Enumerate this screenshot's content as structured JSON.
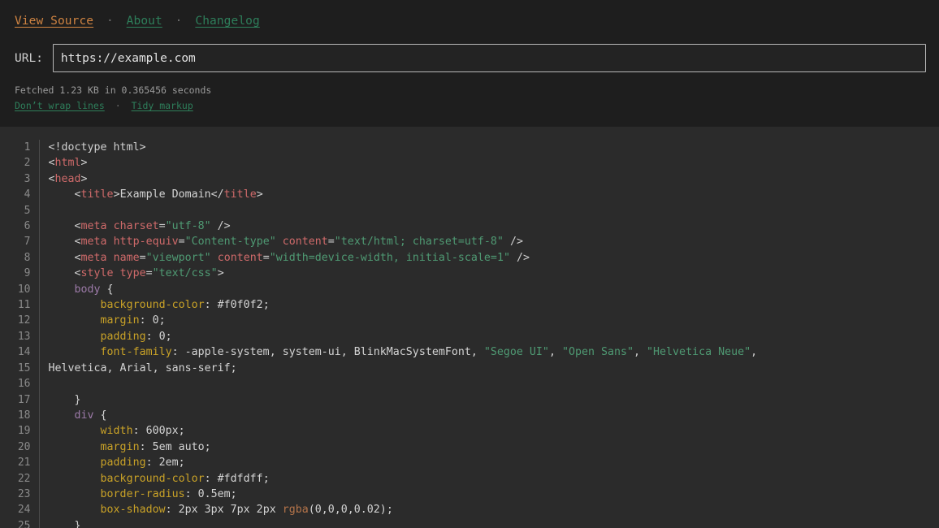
{
  "header": {
    "nav": [
      {
        "label": "View Source",
        "state": "active"
      },
      {
        "label": "About",
        "state": "normal"
      },
      {
        "label": "Changelog",
        "state": "normal"
      }
    ],
    "nav_separator": "·",
    "url_label": "URL:",
    "url_value": "https://example.com",
    "url_placeholder": "https://example.com",
    "fetch_info": "Fetched 1.23 KB in 0.365456 seconds",
    "options": [
      {
        "label": "Don’t wrap lines"
      },
      {
        "label": "Tidy markup"
      }
    ],
    "option_separator": "·"
  },
  "colors": {
    "header_bg": "#1e1e1e",
    "code_bg": "#2b2b2b",
    "accent_active": "#d08442",
    "link_green": "#2e7f5b",
    "gutter_text": "#8a8a8a",
    "tag": "#cf6a6a",
    "string": "#4f9a73",
    "selector": "#9c7aa8",
    "property": "#c9a227",
    "function": "#b5744a",
    "plain": "#d4d4d4"
  },
  "code": {
    "language": "html",
    "lines": [
      {
        "n": "1",
        "tokens": [
          {
            "t": "punct",
            "s": "<!doctype html>"
          }
        ]
      },
      {
        "n": "2",
        "tokens": [
          {
            "t": "punct",
            "s": "<"
          },
          {
            "t": "tag",
            "s": "html"
          },
          {
            "t": "punct",
            "s": ">"
          }
        ]
      },
      {
        "n": "3",
        "tokens": [
          {
            "t": "punct",
            "s": "<"
          },
          {
            "t": "tag",
            "s": "head"
          },
          {
            "t": "punct",
            "s": ">"
          }
        ]
      },
      {
        "n": "4",
        "tokens": [
          {
            "t": "punct",
            "s": "    <"
          },
          {
            "t": "tag",
            "s": "title"
          },
          {
            "t": "punct",
            "s": ">"
          },
          {
            "t": "text",
            "s": "Example Domain"
          },
          {
            "t": "punct",
            "s": "</"
          },
          {
            "t": "tag",
            "s": "title"
          },
          {
            "t": "punct",
            "s": ">"
          }
        ]
      },
      {
        "n": "5",
        "tokens": [
          {
            "t": "punct",
            "s": ""
          }
        ]
      },
      {
        "n": "6",
        "tokens": [
          {
            "t": "punct",
            "s": "    <"
          },
          {
            "t": "tag",
            "s": "meta "
          },
          {
            "t": "attr",
            "s": "charset"
          },
          {
            "t": "punct",
            "s": "="
          },
          {
            "t": "string",
            "s": "\"utf-8\""
          },
          {
            "t": "punct",
            "s": " />"
          }
        ]
      },
      {
        "n": "7",
        "tokens": [
          {
            "t": "punct",
            "s": "    <"
          },
          {
            "t": "tag",
            "s": "meta "
          },
          {
            "t": "attr",
            "s": "http-equiv"
          },
          {
            "t": "punct",
            "s": "="
          },
          {
            "t": "string",
            "s": "\"Content-type\""
          },
          {
            "t": "punct",
            "s": " "
          },
          {
            "t": "attr",
            "s": "content"
          },
          {
            "t": "punct",
            "s": "="
          },
          {
            "t": "string",
            "s": "\"text/html; charset=utf-8\""
          },
          {
            "t": "punct",
            "s": " />"
          }
        ]
      },
      {
        "n": "8",
        "tokens": [
          {
            "t": "punct",
            "s": "    <"
          },
          {
            "t": "tag",
            "s": "meta "
          },
          {
            "t": "attr",
            "s": "name"
          },
          {
            "t": "punct",
            "s": "="
          },
          {
            "t": "string",
            "s": "\"viewport\""
          },
          {
            "t": "punct",
            "s": " "
          },
          {
            "t": "attr",
            "s": "content"
          },
          {
            "t": "punct",
            "s": "="
          },
          {
            "t": "string",
            "s": "\"width=device-width, initial-scale=1\""
          },
          {
            "t": "punct",
            "s": " />"
          }
        ]
      },
      {
        "n": "9",
        "tokens": [
          {
            "t": "punct",
            "s": "    <"
          },
          {
            "t": "tag",
            "s": "style "
          },
          {
            "t": "attr",
            "s": "type"
          },
          {
            "t": "punct",
            "s": "="
          },
          {
            "t": "string",
            "s": "\"text/css\""
          },
          {
            "t": "punct",
            "s": ">"
          }
        ]
      },
      {
        "n": "10",
        "tokens": [
          {
            "t": "sel",
            "s": "    body"
          },
          {
            "t": "val",
            "s": " {"
          }
        ]
      },
      {
        "n": "11",
        "tokens": [
          {
            "t": "prop",
            "s": "        background-color"
          },
          {
            "t": "val",
            "s": ": #f0f0f2;"
          }
        ]
      },
      {
        "n": "12",
        "tokens": [
          {
            "t": "prop",
            "s": "        margin"
          },
          {
            "t": "val",
            "s": ": 0;"
          }
        ]
      },
      {
        "n": "13",
        "tokens": [
          {
            "t": "prop",
            "s": "        padding"
          },
          {
            "t": "val",
            "s": ": 0;"
          }
        ]
      },
      {
        "n": "14",
        "tokens": [
          {
            "t": "prop",
            "s": "        font-family"
          },
          {
            "t": "val",
            "s": ": -apple-system, system-ui, BlinkMacSystemFont, "
          },
          {
            "t": "string",
            "s": "\"Segoe UI\""
          },
          {
            "t": "val",
            "s": ", "
          },
          {
            "t": "string",
            "s": "\"Open Sans\""
          },
          {
            "t": "val",
            "s": ", "
          },
          {
            "t": "string",
            "s": "\"Helvetica Neue\""
          },
          {
            "t": "val",
            "s": ","
          }
        ]
      },
      {
        "n": "15",
        "tokens": [
          {
            "t": "val",
            "s": "Helvetica, Arial, sans-serif;"
          }
        ]
      },
      {
        "n": "16",
        "tokens": [
          {
            "t": "val",
            "s": ""
          }
        ]
      },
      {
        "n": "17",
        "tokens": [
          {
            "t": "val",
            "s": "    }"
          }
        ]
      },
      {
        "n": "18",
        "tokens": [
          {
            "t": "sel",
            "s": "    div"
          },
          {
            "t": "val",
            "s": " {"
          }
        ]
      },
      {
        "n": "19",
        "tokens": [
          {
            "t": "prop",
            "s": "        width"
          },
          {
            "t": "val",
            "s": ": 600px;"
          }
        ]
      },
      {
        "n": "20",
        "tokens": [
          {
            "t": "prop",
            "s": "        margin"
          },
          {
            "t": "val",
            "s": ": 5em auto;"
          }
        ]
      },
      {
        "n": "21",
        "tokens": [
          {
            "t": "prop",
            "s": "        padding"
          },
          {
            "t": "val",
            "s": ": 2em;"
          }
        ]
      },
      {
        "n": "22",
        "tokens": [
          {
            "t": "prop",
            "s": "        background-color"
          },
          {
            "t": "val",
            "s": ": #fdfdff;"
          }
        ]
      },
      {
        "n": "23",
        "tokens": [
          {
            "t": "prop",
            "s": "        border-radius"
          },
          {
            "t": "val",
            "s": ": 0.5em;"
          }
        ]
      },
      {
        "n": "24",
        "tokens": [
          {
            "t": "prop",
            "s": "        box-shadow"
          },
          {
            "t": "val",
            "s": ": 2px 3px 7px 2px "
          },
          {
            "t": "func",
            "s": "rgba"
          },
          {
            "t": "val",
            "s": "(0,0,0,0.02);"
          }
        ]
      },
      {
        "n": "25",
        "tokens": [
          {
            "t": "val",
            "s": "    }"
          }
        ]
      }
    ]
  }
}
